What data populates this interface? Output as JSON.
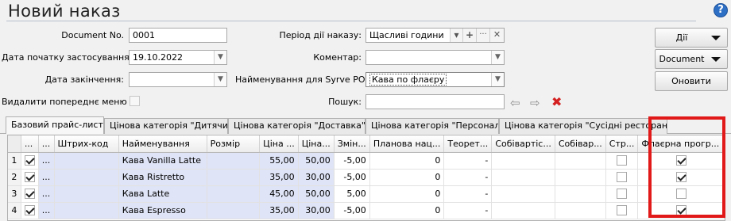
{
  "title": "Новий наказ",
  "form": {
    "doc_no_label": "Document No.",
    "doc_no": "0001",
    "start_label": "Дата початку застосування:",
    "start_date": "19.10.2022",
    "end_label": "Дата закінчення:",
    "end_date": "",
    "delete_label": "Видалити попереднє меню",
    "period_label": "Період дії наказу:",
    "period_value": "Щасливі години",
    "comment_label": "Коментар:",
    "comment_value": "",
    "syrve_label": "Найменування для Syrve POS:",
    "syrve_value": "Кава по флаєру",
    "search_label": "Пошук:",
    "search_value": ""
  },
  "buttons": {
    "actions": "Дії",
    "document": "Document",
    "update": "Оновити"
  },
  "tabs": [
    "Базовий прайс-лист",
    "Цінова категорія \"Дитячий\"",
    "Цінова категорія \"Доставка\"",
    "Цінова категорія \"Персонал\"",
    "Цінова категорія \"Сусідні ресторани\""
  ],
  "table": {
    "headers": [
      "",
      "...",
      "...",
      "Штрих-код",
      "Найменування",
      "Розмір",
      "Ціна ...",
      "Ціна...",
      "Змін...",
      "Планова нац...",
      "Теорет...",
      "Собівартіс...",
      "Собівар...",
      "Стр...",
      "Флаєрна прогр..."
    ],
    "rows": [
      {
        "n": "1",
        "chk": true,
        "dots": "...",
        "barcode": "",
        "name": "Кава Vanilla Latte",
        "size": "",
        "price1": "55,00",
        "price2": "50,00",
        "change": "-5,00",
        "margin": "0",
        "theor": "-",
        "cost1": "",
        "cost2": "",
        "str": false,
        "flyer": true
      },
      {
        "n": "2",
        "chk": true,
        "dots": "...",
        "barcode": "",
        "name": "Кава Ristretto",
        "size": "",
        "price1": "35,00",
        "price2": "30,00",
        "change": "-5,00",
        "margin": "0",
        "theor": "-",
        "cost1": "",
        "cost2": "",
        "str": false,
        "flyer": true
      },
      {
        "n": "3",
        "chk": true,
        "dots": "...",
        "barcode": "",
        "name": "Кава Latte",
        "size": "",
        "price1": "45,00",
        "price2": "50,00",
        "change": "5,00",
        "margin": "0",
        "theor": "-",
        "cost1": "",
        "cost2": "",
        "str": false,
        "flyer": false
      },
      {
        "n": "4",
        "chk": true,
        "dots": "...",
        "barcode": "",
        "name": "Кава Espresso",
        "size": "",
        "price1": "35,00",
        "price2": "30,00",
        "change": "-5,00",
        "margin": "0",
        "theor": "-",
        "cost1": "",
        "cost2": "",
        "str": false,
        "flyer": true
      }
    ]
  },
  "colors": {
    "highlight": "#e21919",
    "selected_row": "#dfe4f6"
  }
}
